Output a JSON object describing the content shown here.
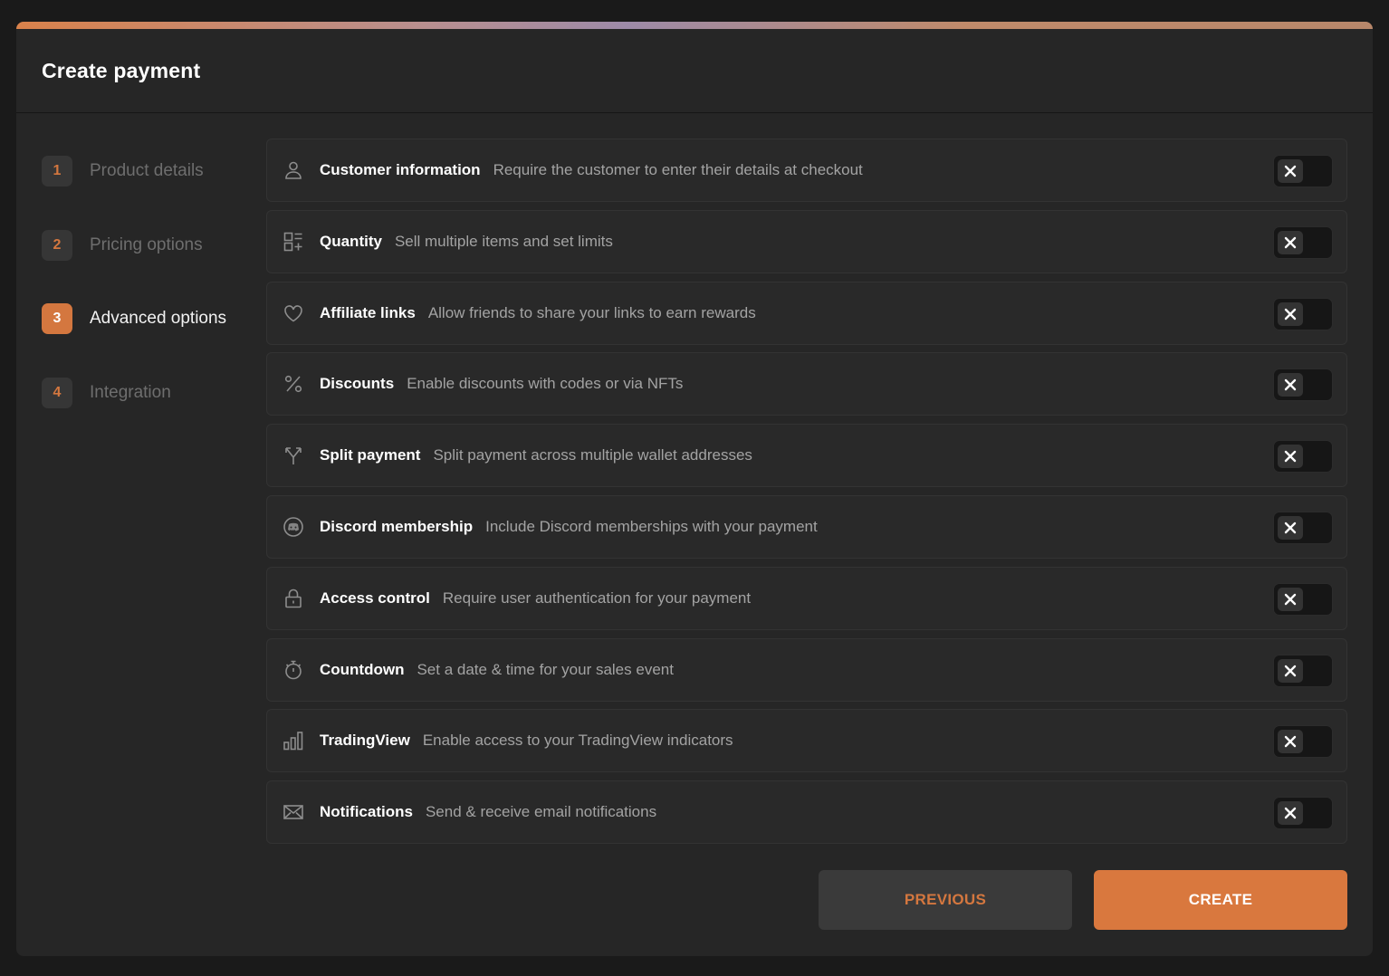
{
  "header": {
    "title": "Create payment"
  },
  "steps": [
    {
      "num": "1",
      "label": "Product details"
    },
    {
      "num": "2",
      "label": "Pricing options"
    },
    {
      "num": "3",
      "label": "Advanced options"
    },
    {
      "num": "4",
      "label": "Integration"
    }
  ],
  "active_step": "3",
  "options": [
    {
      "icon": "user-icon",
      "title": "Customer information",
      "desc": "Require the customer to enter their details at checkout",
      "enabled": false
    },
    {
      "icon": "quantity-grid-icon",
      "title": "Quantity",
      "desc": "Sell multiple items and set limits",
      "enabled": false
    },
    {
      "icon": "heart-icon",
      "title": "Affiliate links",
      "desc": "Allow friends to share your links to earn rewards",
      "enabled": false
    },
    {
      "icon": "percent-icon",
      "title": "Discounts",
      "desc": "Enable discounts with codes or via NFTs",
      "enabled": false
    },
    {
      "icon": "split-arrows-icon",
      "title": "Split payment",
      "desc": "Split payment across multiple wallet addresses",
      "enabled": false
    },
    {
      "icon": "discord-icon",
      "title": "Discord membership",
      "desc": "Include Discord memberships with your payment",
      "enabled": false
    },
    {
      "icon": "lock-icon",
      "title": "Access control",
      "desc": "Require user authentication for your payment",
      "enabled": false
    },
    {
      "icon": "stopwatch-icon",
      "title": "Countdown",
      "desc": "Set a date & time for your sales event",
      "enabled": false
    },
    {
      "icon": "bar-chart-icon",
      "title": "TradingView",
      "desc": "Enable access to your TradingView indicators",
      "enabled": false
    },
    {
      "icon": "envelope-icon",
      "title": "Notifications",
      "desc": "Send & receive email notifications",
      "enabled": false
    }
  ],
  "buttons": {
    "previous": "PREVIOUS",
    "create": "CREATE"
  },
  "colors": {
    "accent": "#d9783e",
    "background": "#262626"
  }
}
